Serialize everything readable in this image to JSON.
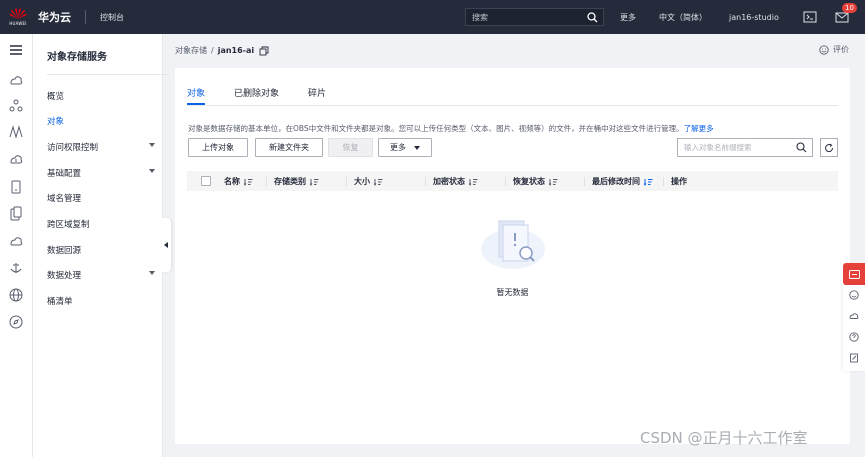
{
  "topbar": {
    "logo_text": "HUAWEI",
    "brand": "华为云",
    "console": "控制台",
    "search_placeholder": "搜索",
    "nav": {
      "more": "更多",
      "language": "中文（简体）",
      "user": "jan16-studio"
    },
    "message_badge": "10",
    "icons": [
      "search-icon",
      "terminal-icon",
      "mail-icon"
    ]
  },
  "rail": {
    "icons": [
      "overview-icon",
      "share-icon",
      "bridge-icon",
      "cloud-down-icon",
      "phone-icon",
      "mobile-icon",
      "cloud-icon",
      "anchor-icon",
      "globe-icon",
      "compass-icon"
    ]
  },
  "sidebar": {
    "title": "对象存储服务",
    "items": [
      {
        "label": "概览",
        "active": false,
        "has_submenu": false
      },
      {
        "label": "对象",
        "active": true,
        "has_submenu": false
      },
      {
        "label": "访问权限控制",
        "active": false,
        "has_submenu": true
      },
      {
        "label": "基础配置",
        "active": false,
        "has_submenu": true
      },
      {
        "label": "域名管理",
        "active": false,
        "has_submenu": false
      },
      {
        "label": "跨区域复制",
        "active": false,
        "has_submenu": false
      },
      {
        "label": "数据回源",
        "active": false,
        "has_submenu": false
      },
      {
        "label": "数据处理",
        "active": false,
        "has_submenu": true
      },
      {
        "label": "桶清单",
        "active": false,
        "has_submenu": false
      }
    ]
  },
  "breadcrumb": {
    "parent": "对象存储",
    "current": "jan16-ai"
  },
  "feedback": "评价",
  "tabs": [
    {
      "label": "对象",
      "active": true
    },
    {
      "label": "已删除对象",
      "active": false
    },
    {
      "label": "碎片",
      "active": false
    }
  ],
  "description": {
    "text": "对象是数据存储的基本单位，在OBS中文件和文件夹都是对象。您可以上传任何类型（文本、图片、视频等）的文件，并在桶中对这些文件进行管理。",
    "link": "了解更多"
  },
  "toolbar": {
    "upload": "上传对象",
    "new_folder": "新建文件夹",
    "restore": "恢复",
    "more": "更多",
    "search_placeholder": "输入对象名前缀搜索"
  },
  "table": {
    "columns": [
      "名称",
      "存储类别",
      "大小",
      "加密状态",
      "恢复状态",
      "最后修改时间",
      "操作"
    ],
    "rows": []
  },
  "empty_text": "暂无数据",
  "watermark": "CSDN @正月十六工作室",
  "colors": {
    "topbar": "#252b3a",
    "accent": "#0c63e4",
    "feedback_red": "#e6403a",
    "huawei_red": "#e60012"
  }
}
